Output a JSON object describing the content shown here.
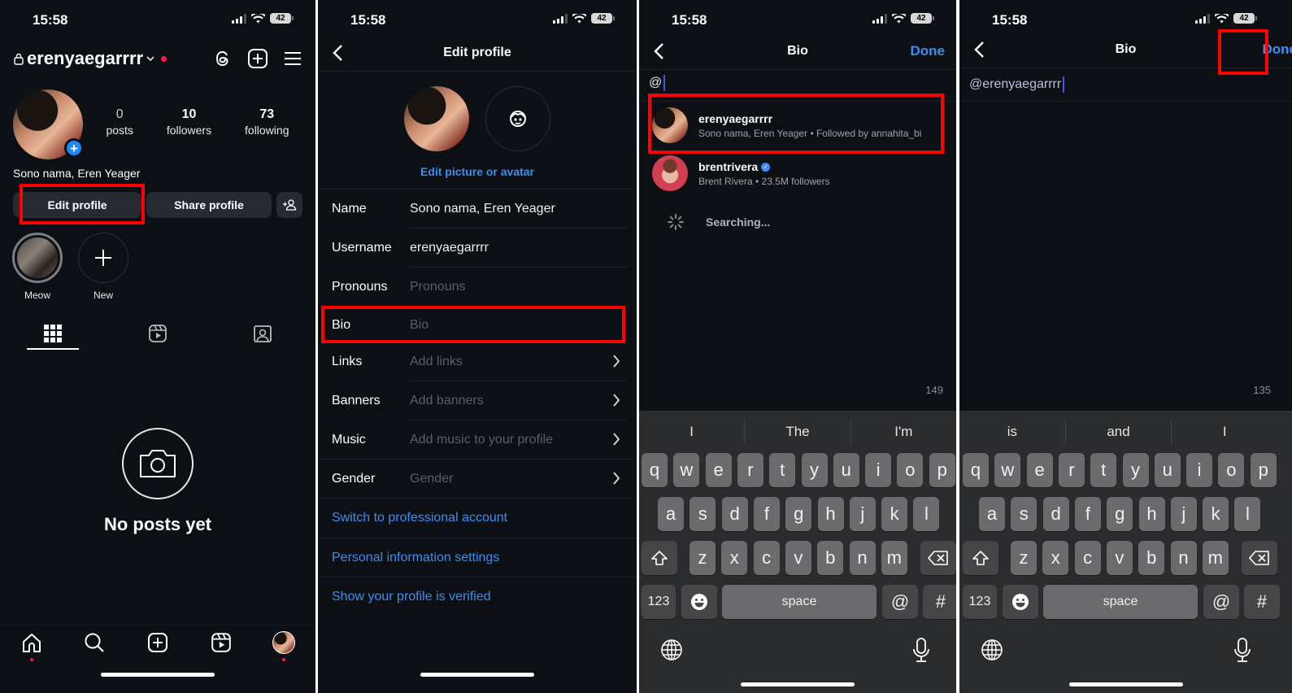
{
  "status": {
    "time": "15:58",
    "battery": "42"
  },
  "screen1": {
    "username": "erenyaegarrrr",
    "stats": [
      {
        "num": "0",
        "label": "posts"
      },
      {
        "num": "10",
        "label": "followers"
      },
      {
        "num": "73",
        "label": "following"
      }
    ],
    "display_name": "Sono nama, Eren Yeager",
    "edit_profile": "Edit profile",
    "share_profile": "Share profile",
    "highlights": [
      {
        "label": "Meow"
      },
      {
        "label": "New"
      }
    ],
    "empty_text": "No posts yet"
  },
  "screen2": {
    "title": "Edit profile",
    "edit_picture": "Edit picture or avatar",
    "fields": [
      {
        "label": "Name",
        "value": "Sono nama, Eren Yeager",
        "placeholder": false,
        "chevron": false
      },
      {
        "label": "Username",
        "value": "erenyaegarrrr",
        "placeholder": false,
        "chevron": false
      },
      {
        "label": "Pronouns",
        "value": "Pronouns",
        "placeholder": true,
        "chevron": false
      },
      {
        "label": "Bio",
        "value": "Bio",
        "placeholder": true,
        "chevron": false
      },
      {
        "label": "Links",
        "value": "Add links",
        "placeholder": true,
        "chevron": true
      },
      {
        "label": "Banners",
        "value": "Add banners",
        "placeholder": true,
        "chevron": true
      },
      {
        "label": "Music",
        "value": "Add music to your profile",
        "placeholder": true,
        "chevron": true
      },
      {
        "label": "Gender",
        "value": "Gender",
        "placeholder": true,
        "chevron": true
      }
    ],
    "links": [
      "Switch to professional account",
      "Personal information settings",
      "Show your profile is verified"
    ]
  },
  "screen3": {
    "title": "Bio",
    "done": "Done",
    "input": "@",
    "suggestions": [
      {
        "username": "erenyaegarrrr",
        "subtitle": "Sono nama, Eren Yeager • Followed by annahita_bi",
        "verified": false
      },
      {
        "username": "brentrivera",
        "subtitle": "Brent Rivera • 23.5M followers",
        "verified": true
      }
    ],
    "searching": "Searching...",
    "counter": "149",
    "predictions": [
      "I",
      "The",
      "I'm"
    ]
  },
  "screen4": {
    "title": "Bio",
    "done": "Done",
    "input": "@erenyaegarrrr",
    "counter": "135",
    "predictions": [
      "is",
      "and",
      "I"
    ]
  },
  "keyboard": {
    "row1": [
      "q",
      "w",
      "e",
      "r",
      "t",
      "y",
      "u",
      "i",
      "o",
      "p"
    ],
    "row2": [
      "a",
      "s",
      "d",
      "f",
      "g",
      "h",
      "j",
      "k",
      "l"
    ],
    "row3": [
      "z",
      "x",
      "c",
      "v",
      "b",
      "n",
      "m"
    ],
    "numbers": "123",
    "space": "space",
    "at": "@",
    "hash": "#"
  },
  "colors": {
    "accent": "#3b8ff0",
    "highlight_box": "#ff0000",
    "background": "#0c0f14",
    "notification": "#ff1744"
  }
}
